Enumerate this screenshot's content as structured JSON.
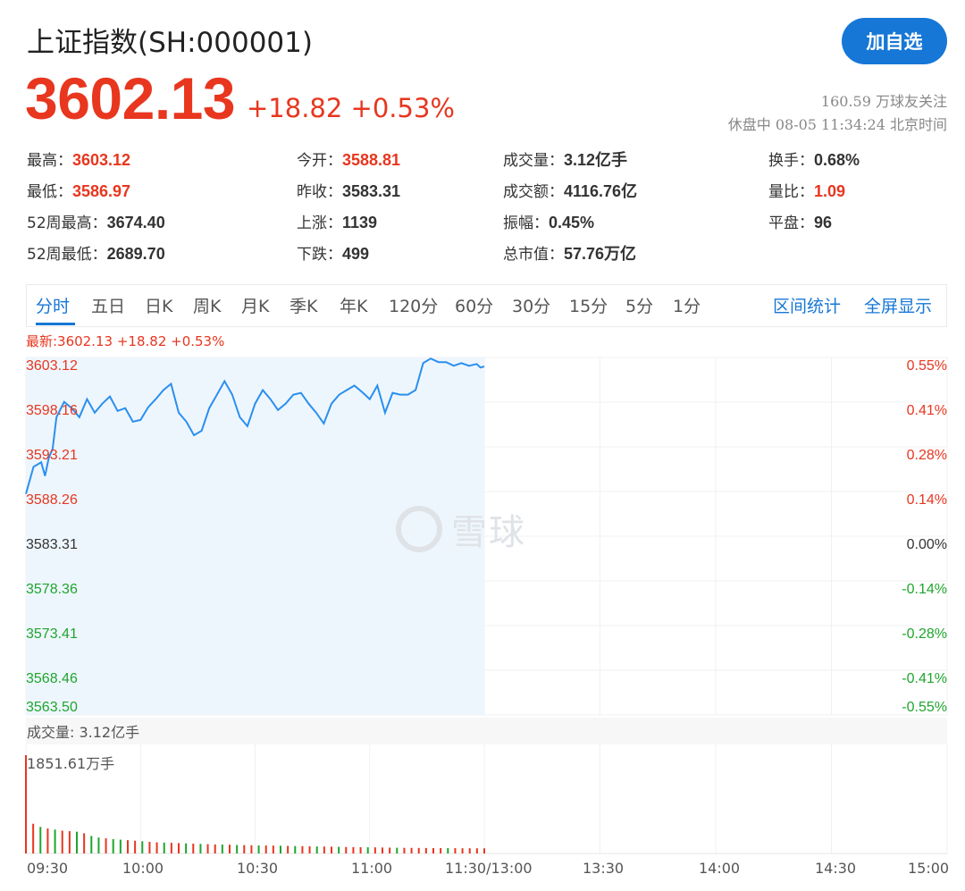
{
  "header": {
    "title": "上证指数(SH:000001)",
    "follow_label": "加自选",
    "price": "3602.13",
    "change": "+18.82 +0.53%",
    "followers": "160.59 万球友关注",
    "status": "休盘中 08-05 11:34:24 北京时间"
  },
  "stats": [
    {
      "label": "最高：",
      "value": "3603.12",
      "color": "red"
    },
    {
      "label": "今开：",
      "value": "3588.81",
      "color": "red"
    },
    {
      "label": "成交量：",
      "value": "3.12亿手",
      "color": "dark"
    },
    {
      "label": "换手：",
      "value": "0.68%",
      "color": "dark"
    },
    {
      "label": "最低：",
      "value": "3586.97",
      "color": "red"
    },
    {
      "label": "昨收：",
      "value": "3583.31",
      "color": "dark"
    },
    {
      "label": "成交额：",
      "value": "4116.76亿",
      "color": "dark"
    },
    {
      "label": "量比：",
      "value": "1.09",
      "color": "red"
    },
    {
      "label": "52周最高：",
      "value": "3674.40",
      "color": "dark"
    },
    {
      "label": "上涨：",
      "value": "1139",
      "color": "dark"
    },
    {
      "label": "振幅：",
      "value": "0.45%",
      "color": "dark"
    },
    {
      "label": "平盘：",
      "value": "96",
      "color": "dark"
    },
    {
      "label": "52周最低：",
      "value": "2689.70",
      "color": "dark"
    },
    {
      "label": "下跌：",
      "value": "499",
      "color": "dark"
    },
    {
      "label": "总市值：",
      "value": "57.76万亿",
      "color": "dark"
    }
  ],
  "tabs": [
    "分时",
    "五日",
    "日K",
    "周K",
    "月K",
    "季K",
    "年K",
    "120分",
    "60分",
    "30分",
    "15分",
    "5分",
    "1分"
  ],
  "active_tab": "分时",
  "tab_links": [
    "区间统计",
    "全屏显示"
  ],
  "latest_line": "最新:3602.13 +18.82 +0.53%",
  "watermark": "雪球",
  "volume_label": "成交量: 3.12亿手",
  "volume_max": "1851.61万手",
  "colors": {
    "up": "#e8361f",
    "down": "#1fa52e",
    "accent": "#1677d6",
    "line": "#2a8ff0",
    "fill": "#eef6fd"
  },
  "chart_data": {
    "type": "line",
    "ylim": [
      3563.5,
      3603.12
    ],
    "ylabels_left": [
      "3603.12",
      "3598.16",
      "3593.21",
      "3588.26",
      "3583.31",
      "3578.36",
      "3573.41",
      "3568.46",
      "3563.50"
    ],
    "ylabels_right": [
      "0.55%",
      "0.41%",
      "0.28%",
      "0.14%",
      "0.00%",
      "-0.14%",
      "-0.28%",
      "-0.41%",
      "-0.55%"
    ],
    "xlabels": [
      "09:30",
      "10:00",
      "10:30",
      "11:00",
      "11:30/13:00",
      "13:30",
      "14:00",
      "14:30",
      "15:00"
    ],
    "minutes": [
      0,
      2,
      4,
      5,
      6,
      7,
      8,
      10,
      12,
      14,
      16,
      18,
      20,
      22,
      24,
      26,
      28,
      30,
      32,
      34,
      36,
      38,
      40,
      42,
      44,
      46,
      48,
      50,
      52,
      54,
      56,
      58,
      60,
      62,
      64,
      66,
      68,
      70,
      72,
      74,
      76,
      78,
      80,
      82,
      84,
      86,
      88,
      90,
      92,
      94,
      96,
      98,
      100,
      102,
      104,
      106,
      108,
      110,
      112,
      114,
      116,
      118,
      119,
      120
    ],
    "prices": [
      3588.0,
      3591.0,
      3591.5,
      3590.0,
      3592.0,
      3593.0,
      3596.5,
      3598.2,
      3597.5,
      3596.5,
      3598.5,
      3597.0,
      3598.0,
      3598.8,
      3597.2,
      3597.5,
      3596.0,
      3596.2,
      3597.6,
      3598.5,
      3599.5,
      3600.2,
      3597.0,
      3596.0,
      3594.5,
      3595.0,
      3597.5,
      3599.0,
      3600.5,
      3599.0,
      3596.5,
      3595.5,
      3598.0,
      3599.5,
      3598.5,
      3597.3,
      3598.0,
      3599.0,
      3599.2,
      3598.0,
      3597.0,
      3595.8,
      3598.0,
      3599.0,
      3599.5,
      3600.0,
      3599.3,
      3598.5,
      3600.0,
      3597.0,
      3599.2,
      3599.0,
      3599.0,
      3599.5,
      3602.5,
      3603.0,
      3602.6,
      3602.6,
      3602.2,
      3602.5,
      3602.2,
      3602.4,
      3602.0,
      3602.13
    ],
    "volume_max": 1851.61,
    "volume": [
      1851.61,
      560,
      500,
      470,
      450,
      430,
      420,
      410,
      380,
      330,
      300,
      285,
      270,
      260,
      250,
      240,
      230,
      220,
      210,
      205,
      200,
      195,
      190,
      185,
      180,
      175,
      170,
      168,
      165,
      160,
      158,
      155,
      150,
      150,
      148,
      145,
      142,
      140,
      138,
      135,
      132,
      130,
      128,
      125,
      122,
      120,
      118,
      116,
      115,
      112,
      110,
      108,
      106,
      105,
      104,
      103,
      102,
      101,
      100,
      100,
      99,
      98,
      98,
      97
    ],
    "volume_up": [
      1,
      1,
      0,
      1,
      0,
      1,
      1,
      0,
      1,
      0,
      0,
      1,
      0,
      0,
      1,
      1,
      0,
      1,
      1,
      0,
      1,
      1,
      0,
      1,
      0,
      1,
      1,
      0,
      1,
      0,
      1,
      1,
      0,
      1,
      1,
      0,
      1,
      0,
      1,
      1,
      0,
      1,
      1,
      0,
      1,
      1,
      1,
      0,
      1,
      1,
      1,
      0,
      1,
      1,
      1,
      1,
      1,
      1,
      0,
      1,
      1,
      1,
      1,
      1
    ]
  }
}
